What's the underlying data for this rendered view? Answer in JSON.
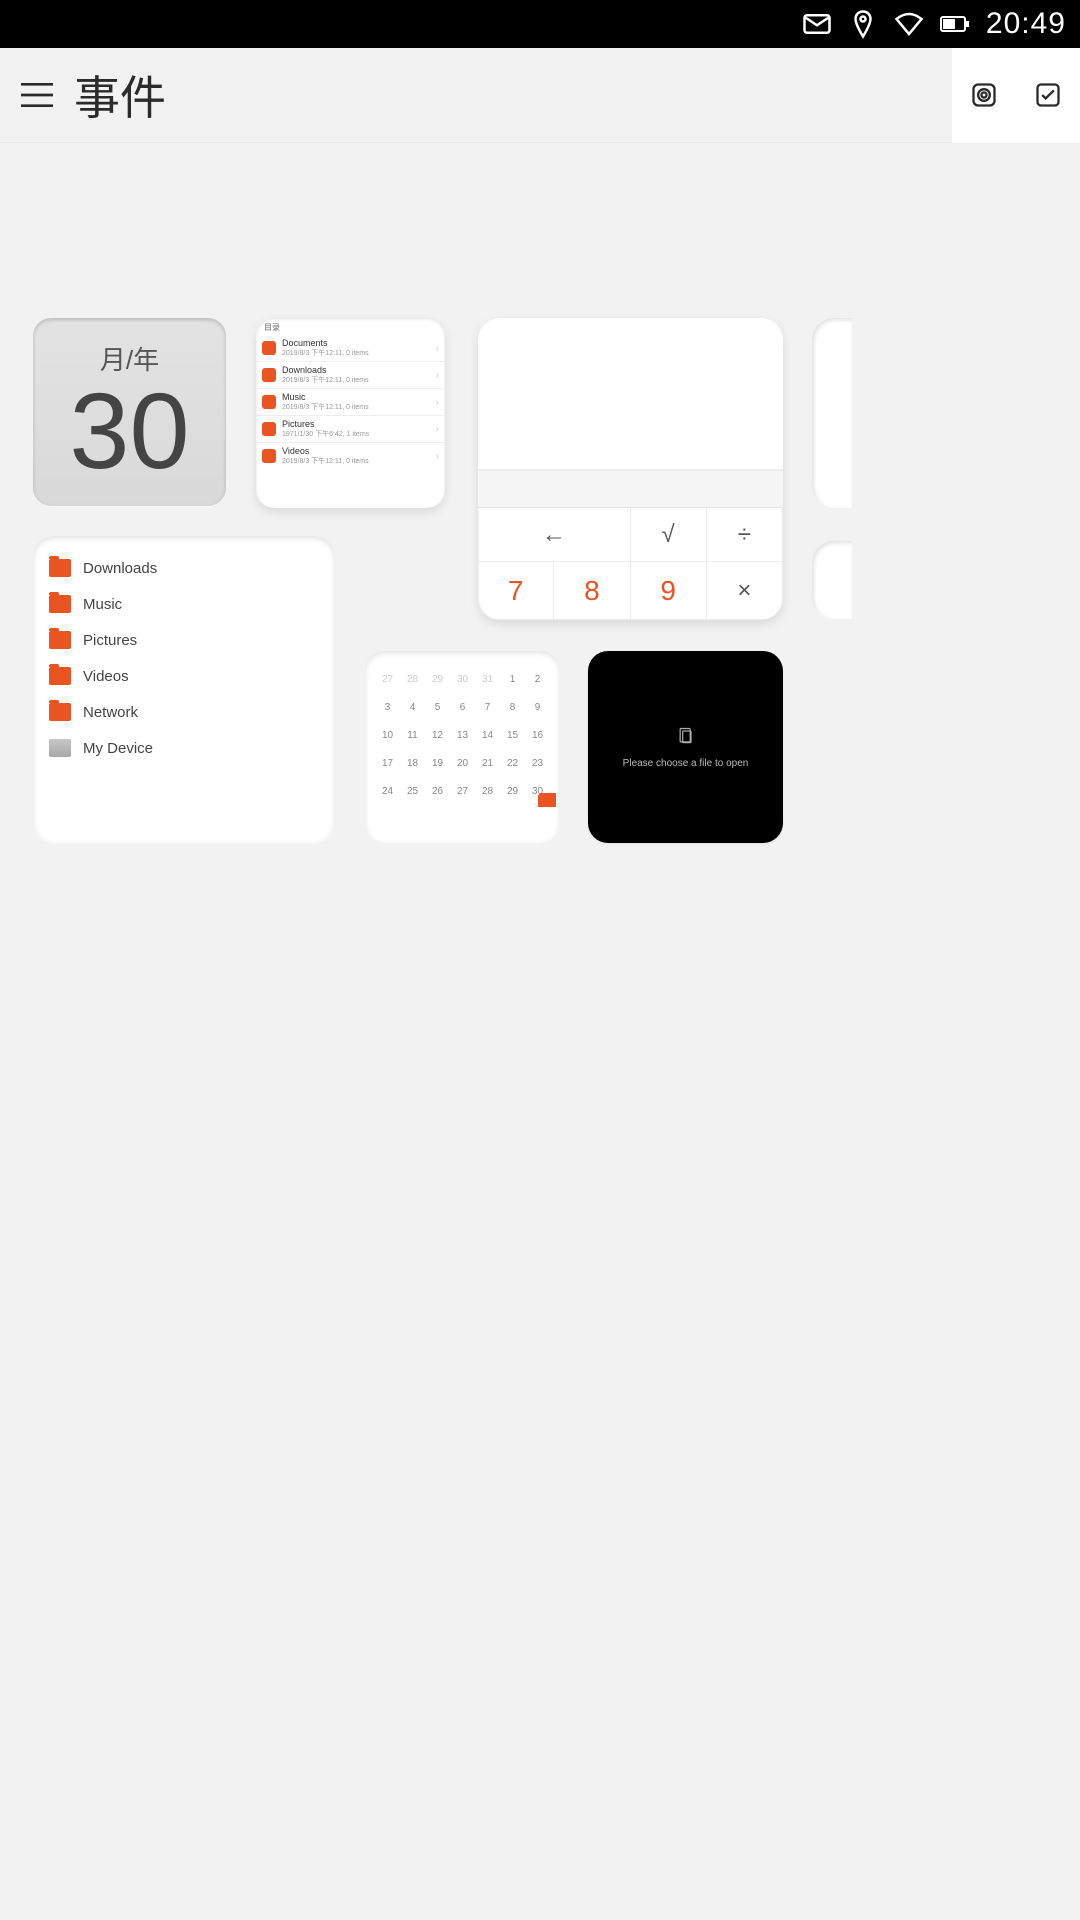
{
  "status": {
    "time": "20:49"
  },
  "header": {
    "title": "事件"
  },
  "day_card": {
    "month_year": "月/年",
    "day": "30"
  },
  "files_small": {
    "header": "目录",
    "items": [
      {
        "name": "Documents",
        "meta": "2019/8/3 下午12:11, 0 items"
      },
      {
        "name": "Downloads",
        "meta": "2019/8/3 下午12:11, 0 items"
      },
      {
        "name": "Music",
        "meta": "2019/8/3 下午12:11, 0 items"
      },
      {
        "name": "Pictures",
        "meta": "1971/1/30 下午6:42, 1 items"
      },
      {
        "name": "Videos",
        "meta": "2019/8/3 下午12:11, 0 items"
      }
    ]
  },
  "calculator": {
    "keys_row1": [
      "←",
      "√",
      "÷"
    ],
    "keys_row2": [
      "7",
      "8",
      "9",
      "×"
    ]
  },
  "files_large": {
    "items": [
      {
        "name": "Downloads",
        "icon": "folder"
      },
      {
        "name": "Music",
        "icon": "folder"
      },
      {
        "name": "Pictures",
        "icon": "folder"
      },
      {
        "name": "Videos",
        "icon": "folder"
      },
      {
        "name": "Network",
        "icon": "folder"
      },
      {
        "name": "My Device",
        "icon": "drive"
      }
    ]
  },
  "month_calendar": {
    "rows": [
      [
        "27",
        "28",
        "29",
        "30",
        "31",
        "1",
        "2"
      ],
      [
        "3",
        "4",
        "5",
        "6",
        "7",
        "8",
        "9"
      ],
      [
        "10",
        "11",
        "12",
        "13",
        "14",
        "15",
        "16"
      ],
      [
        "17",
        "18",
        "19",
        "20",
        "21",
        "22",
        "23"
      ],
      [
        "24",
        "25",
        "26",
        "27",
        "28",
        "29",
        "30"
      ]
    ]
  },
  "dark_card": {
    "message": "Please choose a file to open"
  }
}
